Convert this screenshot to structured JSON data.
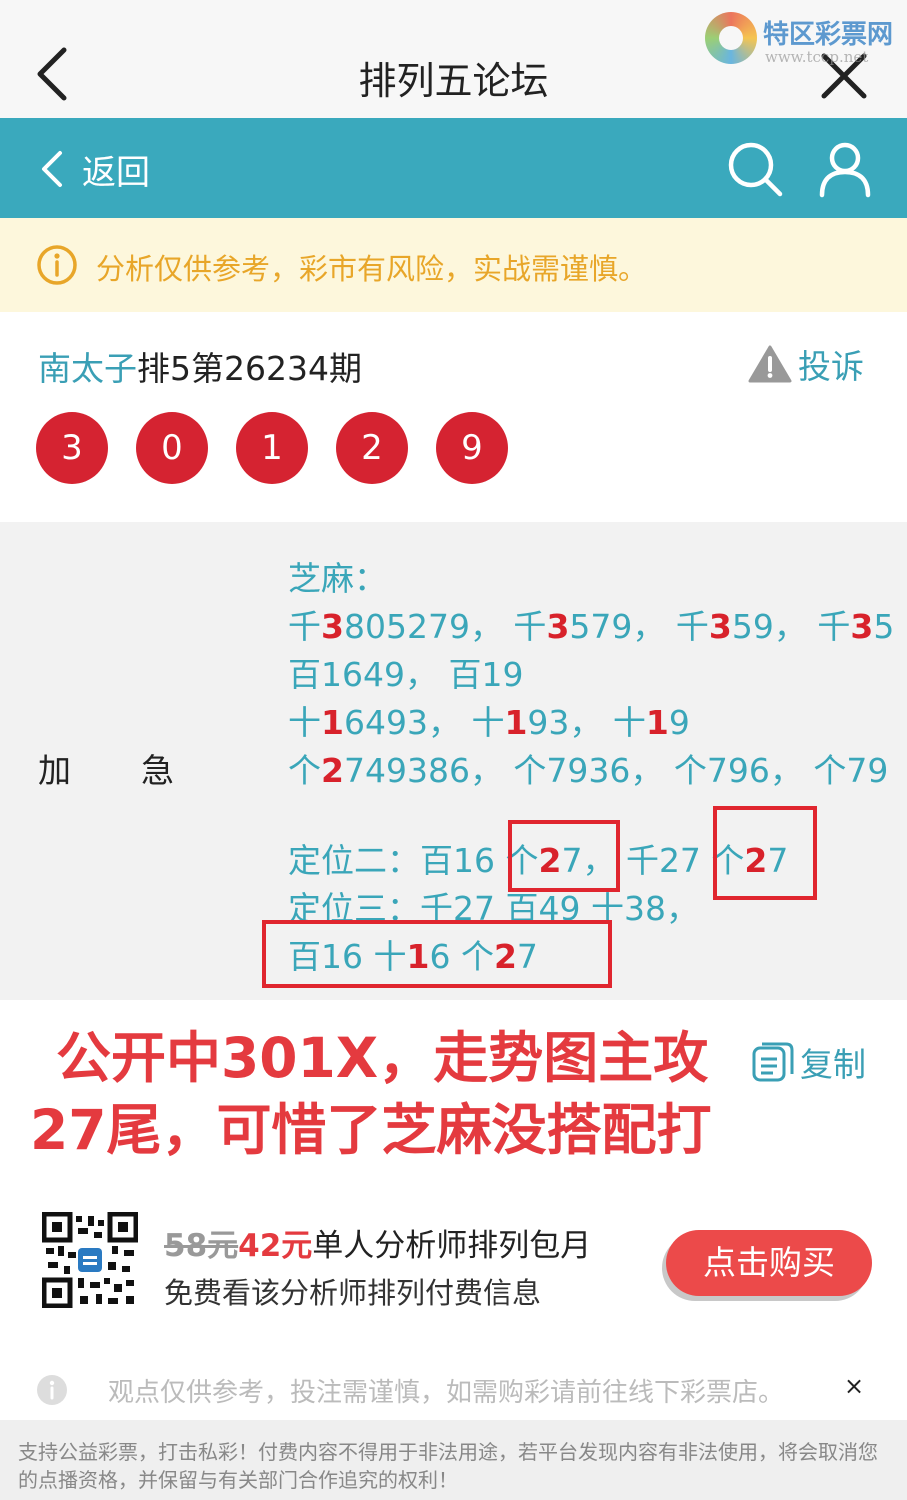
{
  "topbar": {
    "title": "排列五论坛",
    "back_icon": "chevron-left-icon",
    "close_icon": "close-icon"
  },
  "watermark": {
    "name": "特区彩票网",
    "url": "www.tccp.net"
  },
  "navbar": {
    "back_label": "返回",
    "bg_color": "#3aa9bd"
  },
  "notice": {
    "text": "分析仅供参考，彩市有风险，实战需谨慎。",
    "color": "#e8a629"
  },
  "post": {
    "author": "南太子",
    "issue": "排5第26234期",
    "report_label": "投诉",
    "numbers": [
      "3",
      "0",
      "1",
      "2",
      "9"
    ]
  },
  "content": {
    "label": "加急",
    "lines": [
      {
        "parts": [
          [
            "芝麻：",
            ""
          ]
        ]
      },
      {
        "parts": [
          [
            "千",
            ""
          ],
          [
            "3",
            "hl"
          ],
          [
            "805279，  千",
            ""
          ],
          [
            "3",
            "hl"
          ],
          [
            "579，  千",
            ""
          ],
          [
            "3",
            "hl"
          ],
          [
            "59，  千",
            ""
          ],
          [
            "3",
            "hl"
          ],
          [
            "5",
            ""
          ]
        ]
      },
      {
        "parts": [
          [
            "百1649，  百19",
            ""
          ]
        ]
      },
      {
        "parts": [
          [
            "十",
            ""
          ],
          [
            "1",
            "hl"
          ],
          [
            "6493，  十",
            ""
          ],
          [
            "1",
            "hl"
          ],
          [
            "93，  十",
            ""
          ],
          [
            "1",
            "hl"
          ],
          [
            "9",
            ""
          ]
        ]
      },
      {
        "parts": [
          [
            "个",
            ""
          ],
          [
            "2",
            "hl"
          ],
          [
            "749386，  个7936，  个796，  个79",
            ""
          ]
        ]
      },
      {
        "parts": [
          [
            "定位二：百16 个",
            ""
          ],
          [
            "2",
            "hl"
          ],
          [
            "7，  千27 个",
            ""
          ],
          [
            "2",
            "hl"
          ],
          [
            "7",
            ""
          ]
        ]
      },
      {
        "parts": [
          [
            "定位三：千27 百49 十38，",
            ""
          ]
        ]
      },
      {
        "parts": [
          [
            "百16 十",
            ""
          ],
          [
            "1",
            "hl"
          ],
          [
            "6 个",
            ""
          ],
          [
            "2",
            "hl"
          ],
          [
            "7",
            ""
          ]
        ]
      }
    ]
  },
  "annotation": {
    "line1": "公开中301X，走势图主攻",
    "line2": "27尾，可惜了芝麻没搭配打"
  },
  "copy_label": "复制",
  "promo": {
    "old_price": "58元",
    "new_price": "42元",
    "title": "单人分析师排列包月",
    "subtitle": "免费看该分析师排列付费信息",
    "buy_label": "点击购买"
  },
  "disclaimer": {
    "text": "观点仅供参考，投注需谨慎，如需购彩请前往线下彩票店。",
    "close": "×"
  },
  "footer": {
    "text": "支持公益彩票，打击私彩！付费内容不得用于非法用途，若平台发现内容有非法使用，将会取消您的点播资格，并保留与有关部门合作追究的权利！"
  }
}
